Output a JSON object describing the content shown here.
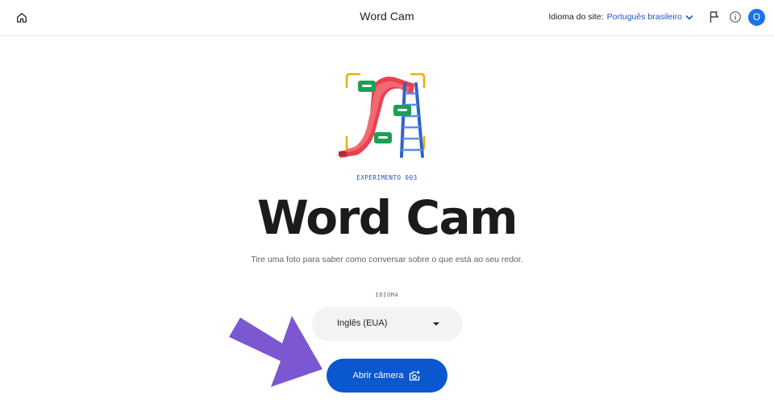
{
  "header": {
    "title": "Word Cam",
    "site_language_label": "Idioma do site:",
    "site_language_value": "Português brasileiro",
    "avatar_initial": "O"
  },
  "hero": {
    "experiment_label": "EXPERIMENTO 003",
    "title": "Word Cam",
    "subtitle": "Tire uma foto para saber como conversar sobre o que está ao seu redor."
  },
  "language": {
    "label": "IDIOMA",
    "selected": "Inglês (EUA)"
  },
  "actions": {
    "open_camera": "Abrir câmera"
  },
  "icons": {
    "home": "home-icon",
    "chevron": "chevron-down-icon",
    "flag": "flag-icon",
    "info": "info-icon",
    "camera": "camera-add-icon",
    "caret": "dropdown-caret-icon"
  },
  "colors": {
    "accent_blue": "#0b57d0",
    "link_blue": "#1a56c4",
    "avatar_blue": "#1a73e8",
    "select_bg": "#f1f3f4",
    "annotation_arrow": "#7b57d1"
  }
}
